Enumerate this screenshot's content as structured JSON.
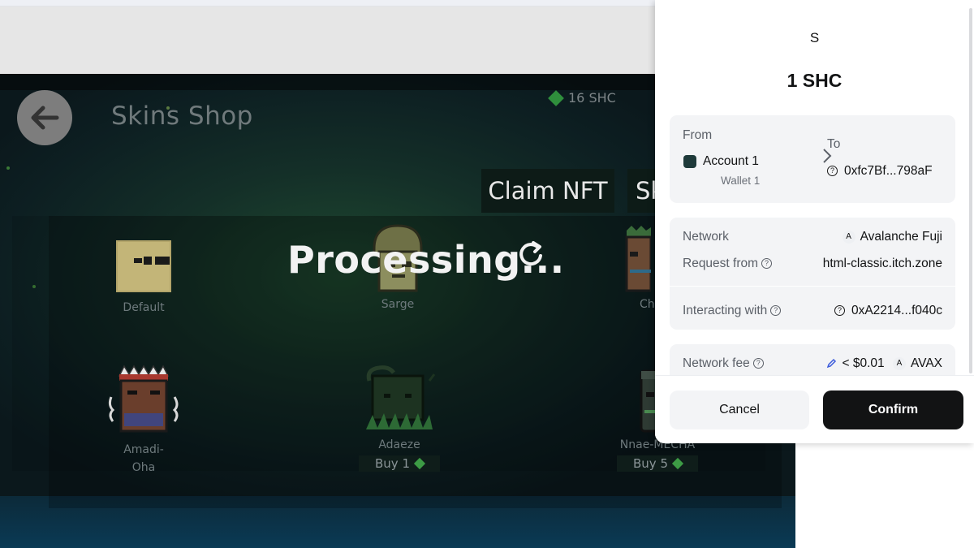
{
  "game": {
    "title": "Skins Shop",
    "balance": "16 SHC",
    "claim_label": "Claim NFT",
    "second_label": "Sk",
    "processing_label": "Processing...",
    "skins": [
      {
        "name": "Default"
      },
      {
        "name": "Sarge"
      },
      {
        "name": "Ch"
      },
      {
        "name": "Amadi-\nOha"
      },
      {
        "name": "Adaeze",
        "price": "Buy 1"
      },
      {
        "name": "Nnae-MECHA",
        "price": "Buy 5"
      }
    ]
  },
  "wallet": {
    "avatar_letter": "S",
    "amount": "1 SHC",
    "from_label": "From",
    "account_name": "Account 1",
    "wallet_name": "Wallet 1",
    "to_label": "To",
    "to_address": "0xfc7Bf...798aF",
    "network_label": "Network",
    "network_icon": "A",
    "network_value": "Avalanche Fuji",
    "request_label": "Request from",
    "request_value": "html-classic.itch.zone",
    "interacting_label": "Interacting with",
    "interacting_value": "0xA2214...f040c",
    "fee_label": "Network fee",
    "fee_value": "< $0.01",
    "fee_token": "AVAX",
    "cancel_label": "Cancel",
    "confirm_label": "Confirm"
  },
  "colors": {
    "confirm_bg": "#121314",
    "card_bg": "#f3f4f6",
    "game_green": "#2f8f3c"
  }
}
